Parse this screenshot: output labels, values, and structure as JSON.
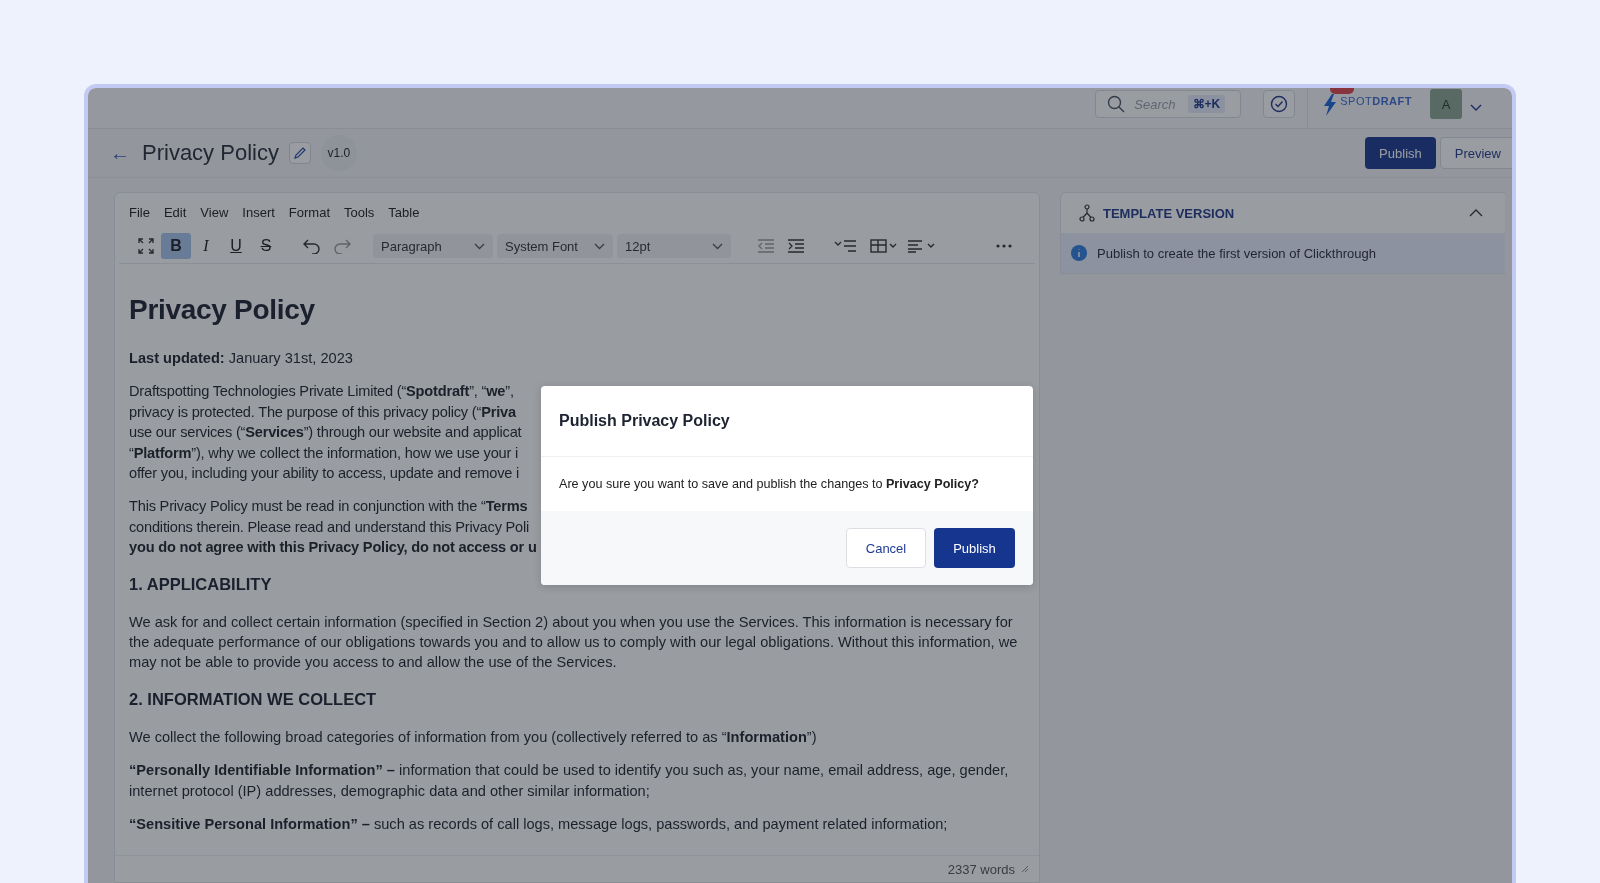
{
  "topbar": {
    "search": {
      "placeholder": "Search",
      "shortcut": "⌘+K"
    },
    "logo": "SPOT**DRAFT**",
    "avatar": "A"
  },
  "header": {
    "back": "←",
    "title": "Privacy Policy",
    "version": "v1.0",
    "buttons": [
      {
        "label": "Publish",
        "kind": "primary"
      },
      {
        "label": "Preview",
        "kind": "secondary"
      }
    ]
  },
  "editor": {
    "menu": [
      "File",
      "Edit",
      "View",
      "Insert",
      "Format",
      "Tools",
      "Table"
    ],
    "format_buttons": [
      {
        "label": "B",
        "kind": "bold",
        "active": true
      },
      {
        "label": "I",
        "kind": "italic",
        "active": false
      },
      {
        "label": "U",
        "kind": "underline",
        "active": false
      },
      {
        "label": "S",
        "kind": "strike",
        "active": false
      }
    ],
    "selects": [
      "Paragraph",
      "System Font",
      "12pt"
    ],
    "document": [
      {
        "kind": "title",
        "text": "Privacy Policy"
      },
      {
        "kind": "para",
        "text": "**Last updated:** January 31st, 2023"
      },
      {
        "kind": "cut",
        "lines": [
          "Draftspotting Technologies Private Limited (“**Spotdraft**”, “**we**”,",
          "privacy is protected. The purpose of this privacy policy (“**Priva**",
          "use our services (“**Services**”) through our website and applicat",
          "“**Platform**”), why we collect the information, how we use your i",
          "offer you, including your ability to access, update and remove i"
        ]
      },
      {
        "kind": "cut",
        "lines": [
          "This Privacy Policy must be read in conjunction with the “**Terms**",
          "conditions therein. Please read and understand this Privacy Poli",
          "**you do not agree with this Privacy Policy, do not access or u**"
        ]
      },
      {
        "kind": "heading",
        "text": "1. APPLICABILITY"
      },
      {
        "kind": "para",
        "text": "We ask for and collect certain information (specified in Section 2) about you when you use the Services. This information is necessary for the adequate performance of our obligations towards you and to allow us to comply with our legal obligations. Without this information, we may not be able to provide you access to and allow the use of the Services."
      },
      {
        "kind": "heading",
        "text": "2. INFORMATION WE COLLECT"
      },
      {
        "kind": "para",
        "text": "We collect the following broad categories of information from you (collectively referred to as “**Information**”)"
      },
      {
        "kind": "para",
        "text": "**“Personally Identifiable Information” –** information that could be used to identify you such as, your name, email address, age, gender, internet protocol (IP) addresses, demographic data and other similar information;"
      },
      {
        "kind": "para",
        "text": "**“Sensitive Personal Information” –** such as records of call logs, message logs, passwords, and payment related information;"
      }
    ],
    "word_count": "2337 words"
  },
  "panel": {
    "title": "TEMPLATE VERSION",
    "expanded": true,
    "info": "Publish to create the first version of Clickthrough"
  },
  "dialog": {
    "title": "Publish Privacy Policy",
    "message": "Are you sure you want to save and publish the changes to **Privacy Policy?**",
    "buttons": [
      {
        "label": "Cancel",
        "kind": "secondary"
      },
      {
        "label": "Publish",
        "kind": "primary"
      }
    ]
  }
}
